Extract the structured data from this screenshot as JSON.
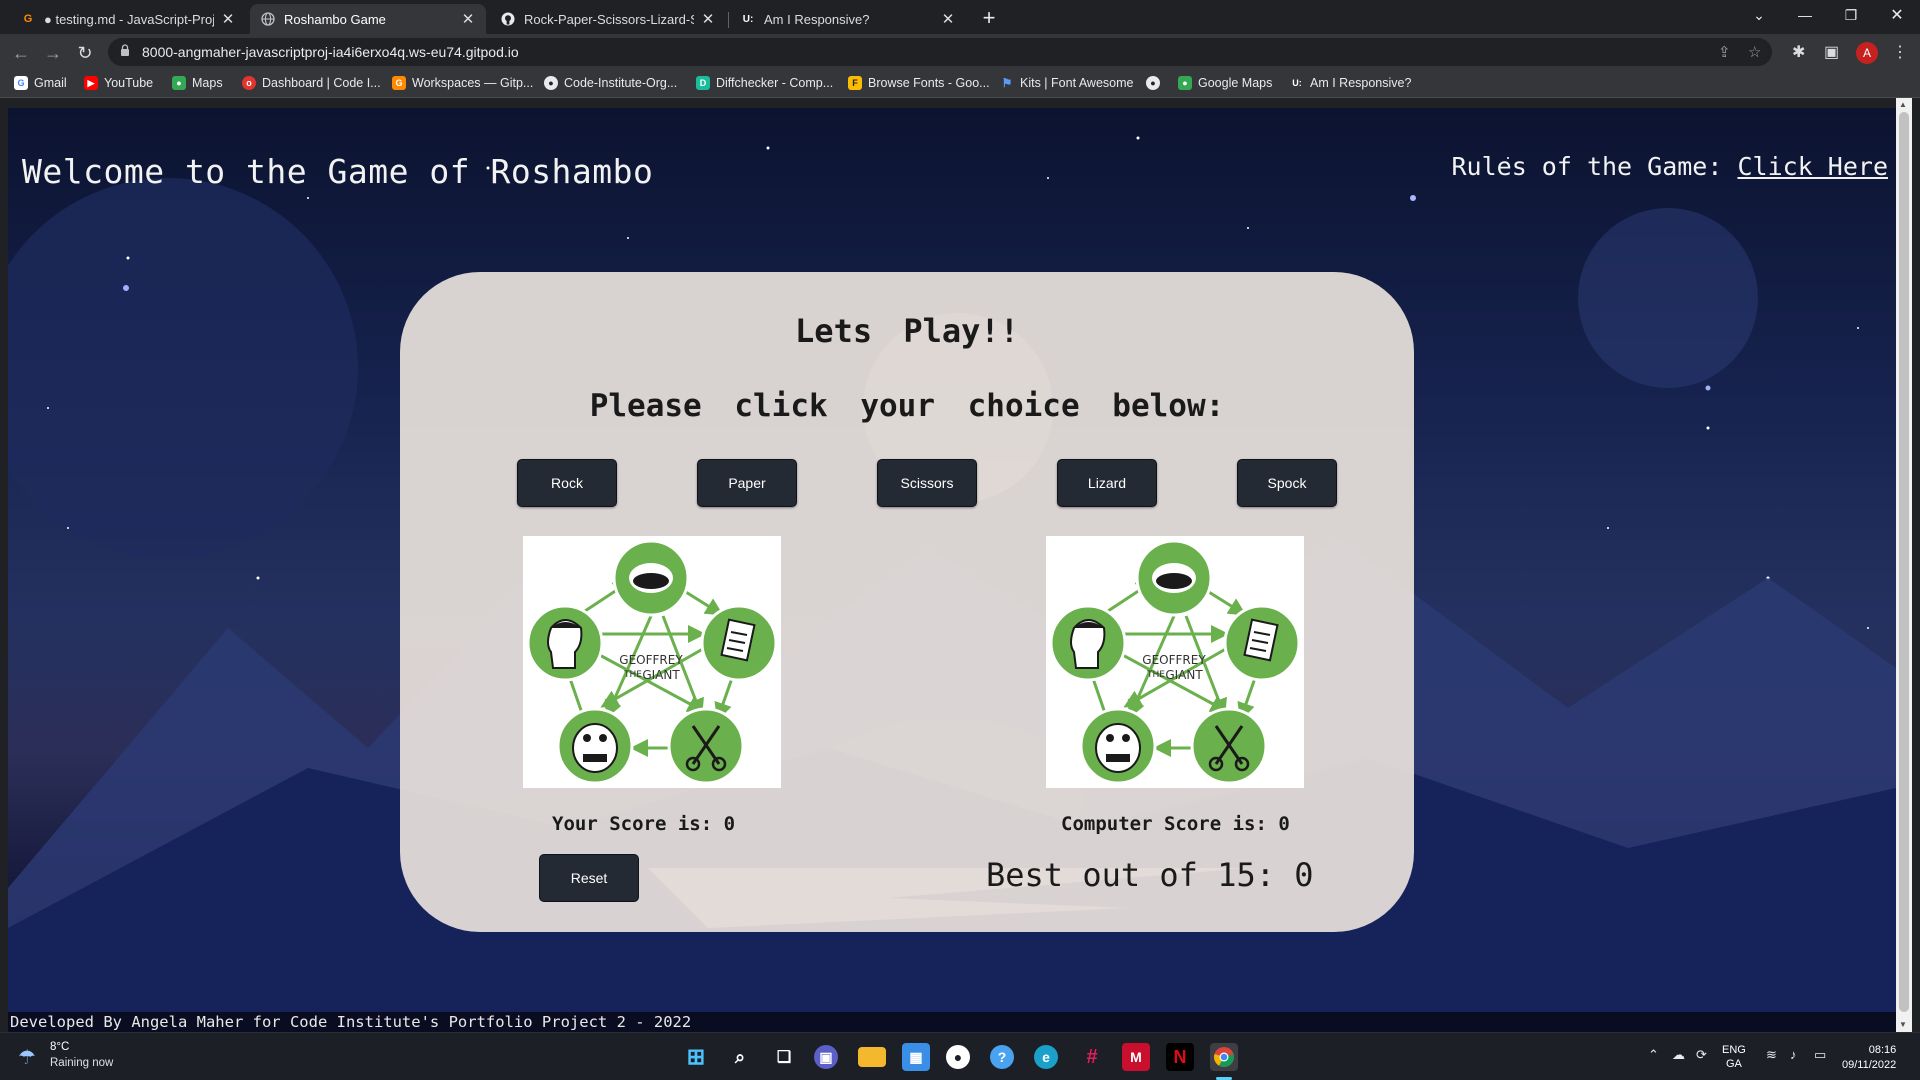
{
  "browser": {
    "tabs": [
      {
        "label": "● testing.md - JavaScript-Project",
        "icon": "gitpod-icon"
      },
      {
        "label": "Roshambo Game",
        "icon": "globe-icon"
      },
      {
        "label": "Rock-Paper-Scissors-Lizard-Spoc",
        "icon": "github-icon"
      },
      {
        "label": "Am I Responsive?",
        "icon": "amiresponsive-icon"
      }
    ],
    "url": "8000-angmaher-javascriptproj-ia4i6erxo4q.ws-eu74.gitpod.io",
    "avatar_letter": "A",
    "bookmarks": [
      {
        "label": "Gmail",
        "icon": "google-icon"
      },
      {
        "label": "YouTube",
        "icon": "youtube-icon"
      },
      {
        "label": "Maps",
        "icon": "maps-pin-icon"
      },
      {
        "label": "Dashboard | Code I...",
        "icon": "code-institute-icon"
      },
      {
        "label": "Workspaces — Gitp...",
        "icon": "gitpod-icon"
      },
      {
        "label": "Code-Institute-Org...",
        "icon": "github-icon"
      },
      {
        "label": "Diffchecker - Comp...",
        "icon": "diffchecker-icon"
      },
      {
        "label": "Browse Fonts - Goo...",
        "icon": "google-fonts-icon"
      },
      {
        "label": "Kits | Font Awesome",
        "icon": "font-awesome-flag-icon"
      },
      {
        "label": "",
        "icon": "github-icon"
      },
      {
        "label": "Google Maps",
        "icon": "maps-pin-icon"
      },
      {
        "label": "Am I Responsive?",
        "icon": "amiresponsive-icon"
      }
    ]
  },
  "page": {
    "heading": "Welcome to the Game of Roshambo",
    "rules_prefix": "Rules of the Game:",
    "rules_link": "Click Here",
    "title": "Lets Play!!",
    "subtitle": "Please click your choice below:",
    "choices": [
      "Rock",
      "Paper",
      "Scissors",
      "Lizard",
      "Spock"
    ],
    "player_image_text": [
      "GEOFFREY",
      "THE",
      "GIANT"
    ],
    "your_score": "Your Score is: 0",
    "computer_score": "Computer Score is: 0",
    "reset_label": "Reset",
    "best_of": "Best out of 15: 0",
    "footer": "Developed By Angela Maher for Code Institute's Portfolio Project 2 - 2022",
    "colors": {
      "panel": "#e9e2dc",
      "button": "#232a33",
      "ring_green": "#6ab04c"
    }
  },
  "taskbar": {
    "temperature": "8°C",
    "weather": "Raining now",
    "lang_top": "ENG",
    "lang_bottom": "GA",
    "time": "08:16",
    "date": "09/11/2022"
  }
}
